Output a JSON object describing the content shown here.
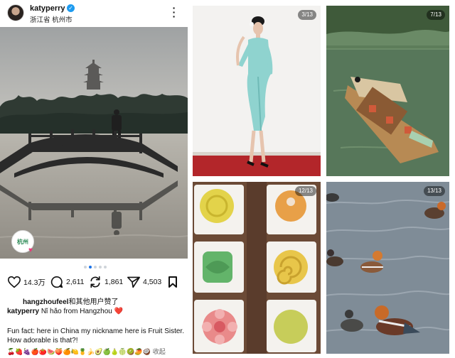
{
  "post": {
    "username": "katyperry",
    "location": "浙江省 杭州市",
    "brand_logo_text": "杭州",
    "counts": {
      "likes": "14.3万",
      "comments": "2,611",
      "reposts": "1,861",
      "shares": "4,503"
    },
    "carousel": {
      "total_dots": 5,
      "active_index": 1
    },
    "liked_by_user": "hangzhoufeel",
    "liked_by_suffix": "和其他用户赞了",
    "caption_user": "katyperry",
    "caption_text": "Nǐ hǎo from Hangzhou ❤️",
    "fun_fact": "Fun fact: here in China my nickname here is Fruit Sister. How adorable is that?!",
    "emoji_row": "🍒🍓🍇🍎🍅🍉🍑🍊🍋🍍🍌🥑🍏🍐🍈🥝🥭🥥",
    "collapse_label": "收起"
  },
  "tiles": [
    {
      "id": "dress",
      "counter": "3/13"
    },
    {
      "id": "boat",
      "counter": "7/13"
    },
    {
      "id": "pastries",
      "counter": "12/13"
    },
    {
      "id": "ducks",
      "counter": "13/13"
    }
  ],
  "colors": {
    "accent_blue": "#1a73e8",
    "verified_blue": "#1d9bf0",
    "heart_red": "#e0245e"
  }
}
